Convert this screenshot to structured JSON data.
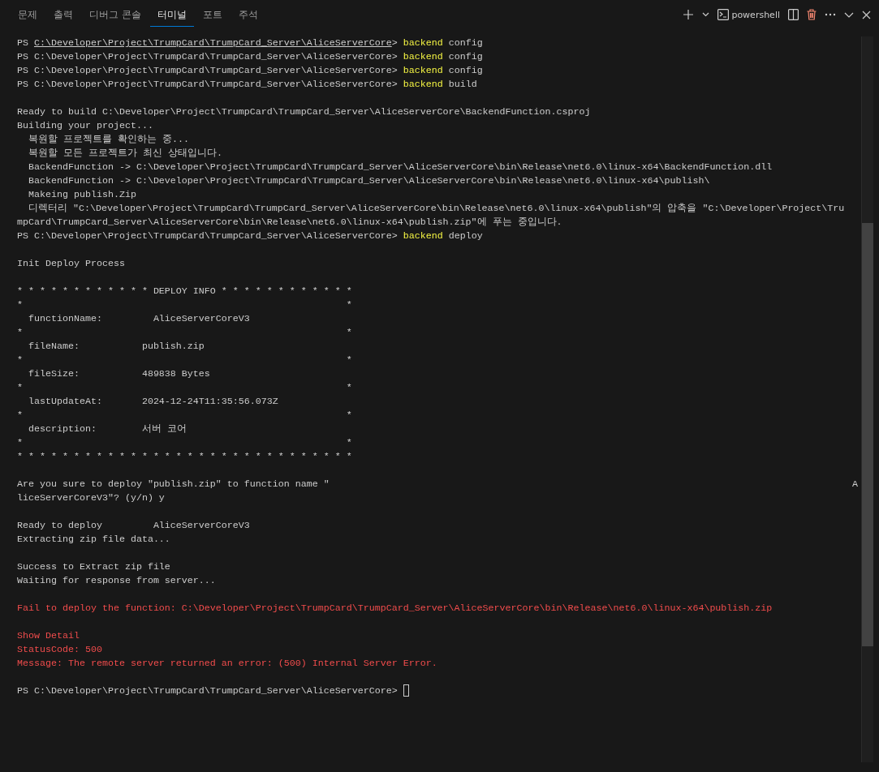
{
  "tabs": [
    {
      "label": "문제",
      "selected": false
    },
    {
      "label": "출력",
      "selected": false
    },
    {
      "label": "디버그 콘솔",
      "selected": false
    },
    {
      "label": "터미널",
      "selected": true
    },
    {
      "label": "포트",
      "selected": false
    },
    {
      "label": "주석",
      "selected": false
    }
  ],
  "toolbar": {
    "shell_label": "powershell"
  },
  "terminal": {
    "lines": [
      {
        "kind": "prompt",
        "shell": "PS",
        "path": "C:\\Developer\\Project\\TrumpCard\\TrumpCard_Server\\AliceServerCore",
        "mark": ">",
        "command": "backend",
        "args": "config",
        "hovered": true,
        "cursor": false
      },
      {
        "kind": "prompt",
        "shell": "PS",
        "path": "C:\\Developer\\Project\\TrumpCard\\TrumpCard_Server\\AliceServerCore",
        "mark": ">",
        "command": "backend",
        "args": "config",
        "hovered": false,
        "cursor": false
      },
      {
        "kind": "prompt",
        "shell": "PS",
        "path": "C:\\Developer\\Project\\TrumpCard\\TrumpCard_Server\\AliceServerCore",
        "mark": ">",
        "command": "backend",
        "args": "config",
        "hovered": false,
        "cursor": false
      },
      {
        "kind": "prompt",
        "shell": "PS",
        "path": "C:\\Developer\\Project\\TrumpCard\\TrumpCard_Server\\AliceServerCore",
        "mark": ">",
        "command": "backend",
        "args": "build",
        "hovered": false,
        "cursor": false
      },
      {
        "kind": "blank"
      },
      {
        "kind": "output",
        "text": "Ready to build C:\\Developer\\Project\\TrumpCard\\TrumpCard_Server\\AliceServerCore\\BackendFunction.csproj"
      },
      {
        "kind": "output",
        "text": "Building your project..."
      },
      {
        "kind": "output",
        "text": "  복원할 프로젝트를 확인하는 중..."
      },
      {
        "kind": "output",
        "text": "  복원할 모든 프로젝트가 최신 상태입니다."
      },
      {
        "kind": "output",
        "text": "  BackendFunction -> C:\\Developer\\Project\\TrumpCard\\TrumpCard_Server\\AliceServerCore\\bin\\Release\\net6.0\\linux-x64\\BackendFunction.dll"
      },
      {
        "kind": "output",
        "text": "  BackendFunction -> C:\\Developer\\Project\\TrumpCard\\TrumpCard_Server\\AliceServerCore\\bin\\Release\\net6.0\\linux-x64\\publish\\"
      },
      {
        "kind": "output",
        "text": "  Makeing publish.Zip"
      },
      {
        "kind": "output",
        "text": "  디렉터리 \"C:\\Developer\\Project\\TrumpCard\\TrumpCard_Server\\AliceServerCore\\bin\\Release\\net6.0\\linux-x64\\publish\"의 압축을 \"C:\\Developer\\Project\\Tru"
      },
      {
        "kind": "output",
        "text": "mpCard\\TrumpCard_Server\\AliceServerCore\\bin\\Release\\net6.0\\linux-x64\\publish.zip\"에 푸는 중입니다."
      },
      {
        "kind": "prompt",
        "shell": "PS",
        "path": "C:\\Developer\\Project\\TrumpCard\\TrumpCard_Server\\AliceServerCore",
        "mark": ">",
        "command": "backend",
        "args": "deploy",
        "hovered": false,
        "cursor": false
      },
      {
        "kind": "blank"
      },
      {
        "kind": "output",
        "text": "Init Deploy Process"
      },
      {
        "kind": "blank"
      },
      {
        "kind": "output",
        "text": "* * * * * * * * * * * * DEPLOY INFO * * * * * * * * * * * *"
      },
      {
        "kind": "output",
        "text": "*                                                         *"
      },
      {
        "kind": "output",
        "text": "  functionName:         AliceServerCoreV3"
      },
      {
        "kind": "output",
        "text": "*                                                         *"
      },
      {
        "kind": "output",
        "text": "  fileName:           publish.zip"
      },
      {
        "kind": "output",
        "text": "*                                                         *"
      },
      {
        "kind": "output",
        "text": "  fileSize:           489838 Bytes"
      },
      {
        "kind": "output",
        "text": "*                                                         *"
      },
      {
        "kind": "output",
        "text": "  lastUpdateAt:       2024-12-24T11:35:56.073Z"
      },
      {
        "kind": "output",
        "text": "*                                                         *"
      },
      {
        "kind": "output",
        "text": "  description:        서버 코어"
      },
      {
        "kind": "output",
        "text": "*                                                         *"
      },
      {
        "kind": "output",
        "text": "* * * * * * * * * * * * * * * * * * * * * * * * * * * * * *"
      },
      {
        "kind": "blank"
      },
      {
        "kind": "wrapped",
        "text": "Are you sure to deploy \"publish.zip\" to function name \"",
        "tail": "A"
      },
      {
        "kind": "output",
        "text": "liceServerCoreV3\"? (y/n) y"
      },
      {
        "kind": "blank"
      },
      {
        "kind": "output",
        "text": "Ready to deploy         AliceServerCoreV3"
      },
      {
        "kind": "output",
        "text": "Extracting zip file data..."
      },
      {
        "kind": "blank"
      },
      {
        "kind": "output",
        "text": "Success to Extract zip file"
      },
      {
        "kind": "output",
        "text": "Waiting for response from server..."
      },
      {
        "kind": "blank"
      },
      {
        "kind": "error",
        "text": "Fail to deploy the function: C:\\Developer\\Project\\TrumpCard\\TrumpCard_Server\\AliceServerCore\\bin\\Release\\net6.0\\linux-x64\\publish.zip"
      },
      {
        "kind": "blank"
      },
      {
        "kind": "error",
        "text": "Show Detail"
      },
      {
        "kind": "error",
        "text": "StatusCode: 500"
      },
      {
        "kind": "error",
        "text": "Message: The remote server returned an error: (500) Internal Server Error."
      },
      {
        "kind": "blank"
      },
      {
        "kind": "prompt",
        "shell": "PS",
        "path": "C:\\Developer\\Project\\TrumpCard\\TrumpCard_Server\\AliceServerCore",
        "mark": ">",
        "hovered": false,
        "cursor": true
      }
    ]
  }
}
